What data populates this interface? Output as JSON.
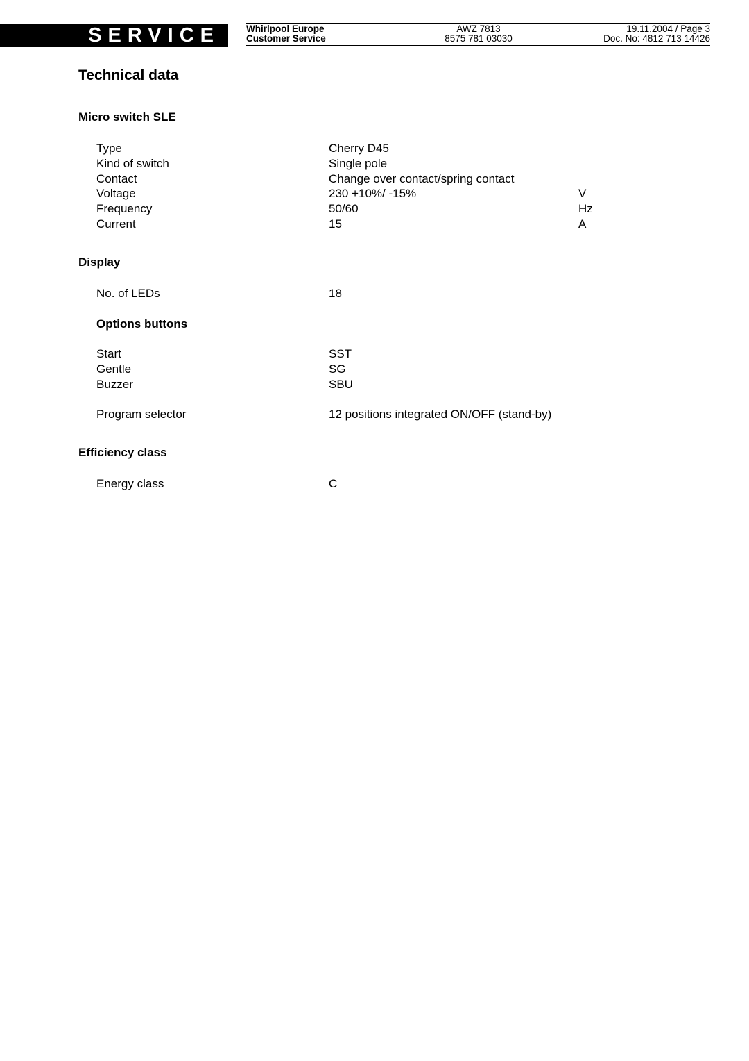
{
  "header": {
    "banner": "SERVICE",
    "company": "Whirlpool Europe",
    "department": "Customer Service",
    "model": "AWZ 7813",
    "part_number": "8575 781 03030",
    "date_page": "19.11.2004 / Page 3",
    "doc_no": "Doc. No: 4812 713 14426"
  },
  "page_title": "Technical data",
  "sections": {
    "micro_switch": {
      "title": "Micro switch SLE",
      "rows": [
        {
          "label": "Type",
          "value": "Cherry D45",
          "unit": ""
        },
        {
          "label": "Kind of switch",
          "value": "Single pole",
          "unit": ""
        },
        {
          "label": "Contact",
          "value": "Change over contact/spring contact",
          "unit": ""
        },
        {
          "label": "Voltage",
          "value": "230 +10%/ -15%",
          "unit": "V"
        },
        {
          "label": "Frequency",
          "value": "50/60",
          "unit": "Hz"
        },
        {
          "label": "Current",
          "value": "15",
          "unit": "A"
        }
      ]
    },
    "display": {
      "title": "Display",
      "rows": [
        {
          "label": "No. of LEDs",
          "value": "18"
        }
      ]
    },
    "options_buttons": {
      "title": "Options buttons",
      "rows": [
        {
          "label": "Start",
          "value": "SST"
        },
        {
          "label": "Gentle",
          "value": "SG"
        },
        {
          "label": "Buzzer",
          "value": "SBU"
        }
      ]
    },
    "program_selector": {
      "label": "Program selector",
      "value": "12 positions integrated ON/OFF (stand-by)"
    },
    "efficiency": {
      "title": "Efficiency class",
      "rows": [
        {
          "label": "Energy class",
          "value": "C"
        }
      ]
    }
  }
}
